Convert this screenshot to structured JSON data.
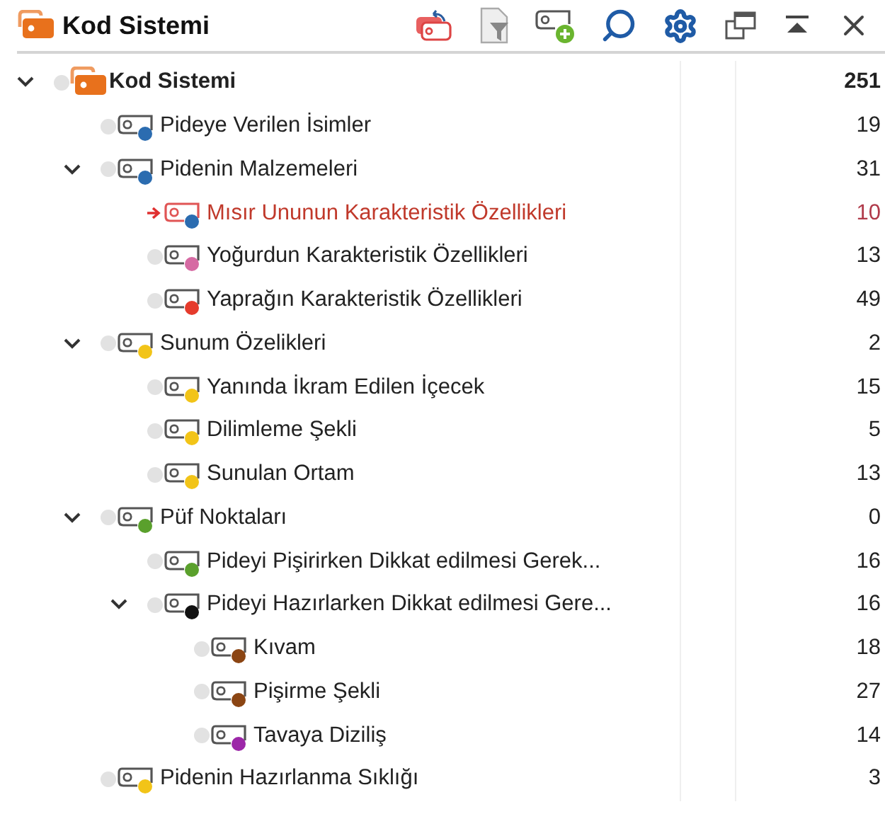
{
  "header": {
    "title": "Kod Sistemi"
  },
  "tree": [
    {
      "kind": "root",
      "label": "Kod Sistemi",
      "count": "251",
      "expanded": true,
      "selected": false,
      "color": "#e8711c",
      "children": [
        {
          "kind": "code",
          "label": "Pideye Verilen İsimler",
          "count": "19",
          "selected": false,
          "color": "#2b6cb0"
        },
        {
          "kind": "code",
          "label": "Pidenin Malzemeleri",
          "count": "31",
          "expanded": true,
          "selected": false,
          "color": "#2b6cb0",
          "children": [
            {
              "kind": "code",
              "label": "Mısır Ununun Karakteristik Özellikleri",
              "count": "10",
              "selected": true,
              "color": "#2b6cb0"
            },
            {
              "kind": "code",
              "label": "Yoğurdun Karakteristik Özellikleri",
              "count": "13",
              "selected": false,
              "color": "#d66aa3"
            },
            {
              "kind": "code",
              "label": "Yaprağın Karakteristik Özellikleri",
              "count": "49",
              "selected": false,
              "color": "#e53b2c"
            }
          ]
        },
        {
          "kind": "code",
          "label": "Sunum Özelikleri",
          "count": "2",
          "expanded": true,
          "selected": false,
          "color": "#f2c418",
          "children": [
            {
              "kind": "code",
              "label": "Yanında İkram Edilen İçecek",
              "count": "15",
              "selected": false,
              "color": "#f2c418"
            },
            {
              "kind": "code",
              "label": "Dilimleme Şekli",
              "count": "5",
              "selected": false,
              "color": "#f2c418"
            },
            {
              "kind": "code",
              "label": "Sunulan Ortam",
              "count": "13",
              "selected": false,
              "color": "#f2c418"
            }
          ]
        },
        {
          "kind": "code",
          "label": "Püf Noktaları",
          "count": "0",
          "expanded": true,
          "selected": false,
          "color": "#5aa02c",
          "children": [
            {
              "kind": "code",
              "label": "Pideyi Pişirirken Dikkat edilmesi Gerek...",
              "count": "16",
              "selected": false,
              "color": "#5aa02c"
            },
            {
              "kind": "code",
              "label": "Pideyi Hazırlarken Dikkat edilmesi Gere...",
              "count": "16",
              "expanded": true,
              "selected": false,
              "color": "#111111",
              "children": [
                {
                  "kind": "code",
                  "label": "Kıvam",
                  "count": "18",
                  "selected": false,
                  "color": "#8b4513"
                },
                {
                  "kind": "code",
                  "label": "Pişirme Şekli",
                  "count": "27",
                  "selected": false,
                  "color": "#8b4513"
                },
                {
                  "kind": "code",
                  "label": "Tavaya Diziliş",
                  "count": "14",
                  "selected": false,
                  "color": "#9c27a8"
                }
              ]
            }
          ]
        },
        {
          "kind": "code",
          "label": "Pidenin Hazırlanma Sıklığı",
          "count": "3",
          "selected": false,
          "color": "#f2c418"
        }
      ]
    }
  ]
}
